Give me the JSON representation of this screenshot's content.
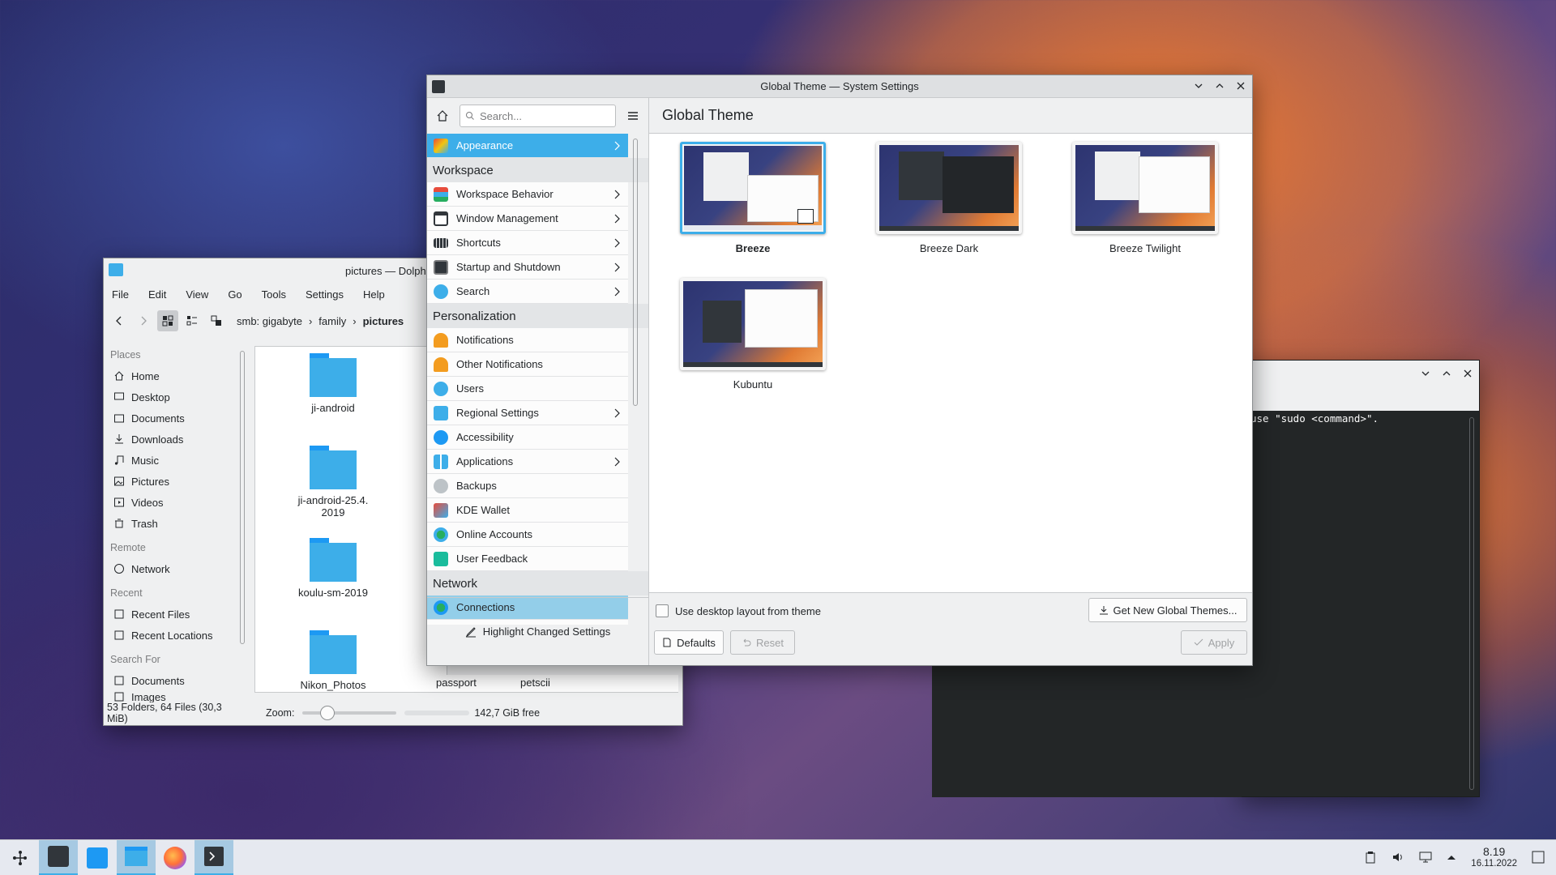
{
  "dolphin": {
    "title": "pictures — Dolphin",
    "menu": [
      "File",
      "Edit",
      "View",
      "Go",
      "Tools",
      "Settings",
      "Help"
    ],
    "breadcrumb": [
      "smb: gigabyte",
      "family",
      "pictures"
    ],
    "places": {
      "places_header": "Places",
      "places": [
        "Home",
        "Desktop",
        "Documents",
        "Downloads",
        "Music",
        "Pictures",
        "Videos",
        "Trash"
      ],
      "remote_header": "Remote",
      "remote": [
        "Network"
      ],
      "recent_header": "Recent",
      "recent": [
        "Recent Files",
        "Recent Locations"
      ],
      "search_header": "Search For",
      "search": [
        "Documents",
        "Images"
      ]
    },
    "files": [
      "ji-android",
      "ji-android-25.4.\n2019",
      "koulu-sm-2019",
      "Nikon_Photos",
      "passport",
      "petscii"
    ],
    "status_count": "53 Folders, 64 Files (30,3 MiB)",
    "zoom_label": "Zoom:",
    "free": "142,7 GiB free"
  },
  "settings": {
    "title": "Global Theme — System Settings",
    "search_placeholder": "Search...",
    "page_title": "Global Theme",
    "appearance": "Appearance",
    "cat_workspace": "Workspace",
    "workspace": [
      "Workspace Behavior",
      "Window Management",
      "Shortcuts",
      "Startup and Shutdown",
      "Search"
    ],
    "cat_personalization": "Personalization",
    "personalization": [
      "Notifications",
      "Other Notifications",
      "Users",
      "Regional Settings",
      "Accessibility",
      "Applications",
      "Backups",
      "KDE Wallet",
      "Online Accounts",
      "User Feedback"
    ],
    "cat_network": "Network",
    "network": [
      "Connections"
    ],
    "highlight": "Highlight Changed Settings",
    "themes": [
      "Breeze",
      "Breeze Dark",
      "Breeze Twilight",
      "Kubuntu"
    ],
    "use_layout": "Use desktop layout from theme",
    "get_new": "Get New Global Themes...",
    "defaults": "Defaults",
    "reset": "Reset",
    "apply": "Apply"
  },
  "terminal": {
    "line": "use \"sudo <command>\"."
  },
  "taskbar": {
    "time": "8.19",
    "date": "16.11.2022"
  },
  "colors": {
    "accent": "#3daee9",
    "selection_light": "#93cee9"
  }
}
